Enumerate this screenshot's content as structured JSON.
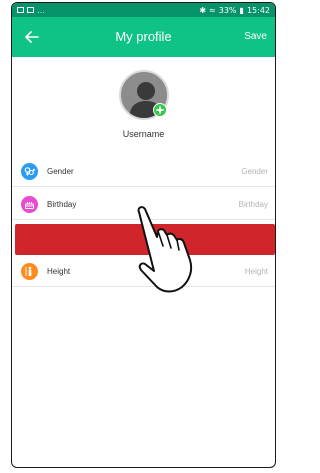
{
  "status_bar": {
    "signal_text": "33%",
    "time": "15:42"
  },
  "appbar": {
    "title": "My profile",
    "save_label": "Save"
  },
  "profile": {
    "username": "Username"
  },
  "rows": [
    {
      "label": "Gender",
      "value": "Gender",
      "icon": "gender-icon",
      "color": "#2b9cf2"
    },
    {
      "label": "Birthday",
      "value": "Birthday",
      "icon": "cake-icon",
      "color": "#e84bd1"
    },
    {
      "label": "Height",
      "value": "Height",
      "icon": "person-height-icon",
      "color": "#ff8a1d"
    }
  ],
  "colors": {
    "status_bar": "#06936a",
    "app_bar": "#0fc387",
    "highlight_bar": "#d0262b",
    "add_badge": "#35c84a"
  }
}
